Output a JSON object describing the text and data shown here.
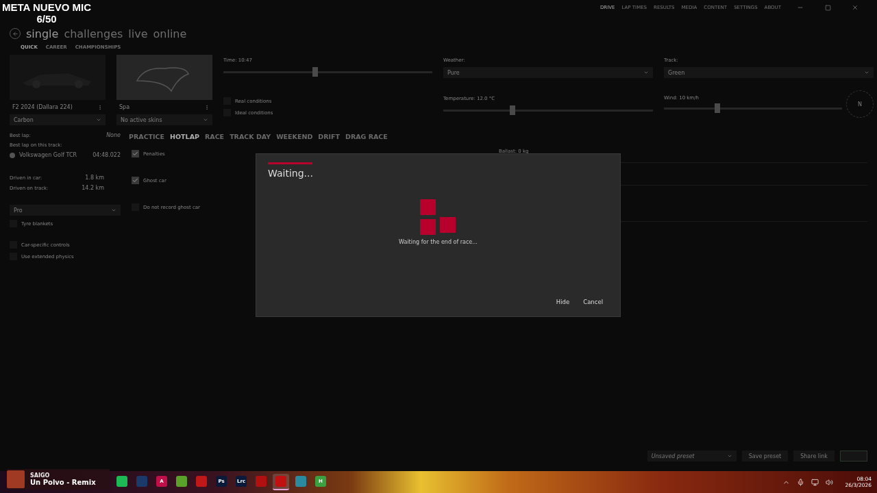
{
  "overlay": {
    "title": "META NUEVO MIC",
    "count": "6/50"
  },
  "nav": [
    {
      "label": "DRIVE",
      "selected": true
    },
    {
      "label": "LAP TIMES",
      "selected": false
    },
    {
      "label": "RESULTS",
      "selected": false
    },
    {
      "label": "MEDIA",
      "selected": false
    },
    {
      "label": "CONTENT",
      "selected": false
    },
    {
      "label": "SETTINGS",
      "selected": false
    },
    {
      "label": "ABOUT",
      "selected": false
    }
  ],
  "title_tabs": [
    {
      "label": "single",
      "selected": true
    },
    {
      "label": "challenges",
      "selected": false
    },
    {
      "label": "live",
      "selected": false
    },
    {
      "label": "online",
      "selected": false
    }
  ],
  "subtabs": [
    {
      "label": "QUICK",
      "selected": true
    },
    {
      "label": "CAREER",
      "selected": false
    },
    {
      "label": "CHAMPIONSHIPS",
      "selected": false
    }
  ],
  "car": {
    "name": "F2 2024 (Dallara 224)",
    "skin": "Carbon"
  },
  "track": {
    "name": "Spa",
    "skins": "No active skins"
  },
  "time": {
    "label": "Time: 10:47",
    "level": 0.44
  },
  "conditions": [
    {
      "label": "Real conditions",
      "checked": false
    },
    {
      "label": "Ideal conditions",
      "checked": false
    }
  ],
  "weather": {
    "label": "Weather:",
    "value": "Pure"
  },
  "track_state": {
    "label": "Track:",
    "value": "Green"
  },
  "temperature": {
    "label": "Temperature: 12.0 °C",
    "level": 0.33
  },
  "wind": {
    "label": "Wind: 10 km/h",
    "level": 0.3,
    "direction": "N"
  },
  "stats": {
    "best_lap_label": "Best lap:",
    "best_lap": "None",
    "best_track_label": "Best lap on this track:",
    "record_car": "Volkswagen Golf TCR",
    "record_time": "04:48.022",
    "rows": [
      {
        "label": "Driven in car:",
        "value": "1.8 km"
      },
      {
        "label": "Driven on track:",
        "value": "14.2 km"
      }
    ]
  },
  "assists": {
    "preset": "Pro",
    "items": [
      {
        "label": "Tyre blankets",
        "checked": false
      },
      {
        "label": "Car-specific controls",
        "checked": false
      },
      {
        "label": "Use extended physics",
        "checked": false
      }
    ]
  },
  "modes": [
    {
      "label": "PRACTICE",
      "selected": false
    },
    {
      "label": "HOTLAP",
      "selected": true
    },
    {
      "label": "RACE",
      "selected": false
    },
    {
      "label": "TRACK DAY",
      "selected": false
    },
    {
      "label": "WEEKEND",
      "selected": false
    },
    {
      "label": "DRIFT",
      "selected": false
    },
    {
      "label": "DRAG RACE",
      "selected": false
    }
  ],
  "options": [
    {
      "label": "Penalties",
      "checked": true
    },
    {
      "label": "Ghost car",
      "checked": true
    },
    {
      "label": "Do not record ghost car",
      "checked": false
    }
  ],
  "ballast": "Ballast: 0 kg",
  "dialog": {
    "title": "Waiting...",
    "message": "Waiting for the end of race...",
    "buttons": [
      "Hide",
      "Cancel"
    ]
  },
  "footer": {
    "preset": "Unsaved preset",
    "buttons": [
      "Save preset",
      "Share link"
    ]
  },
  "media": {
    "artist": "SAIGO",
    "song": "Un Polvo - Remix"
  },
  "taskbar_apps": [
    {
      "kind": "spotify"
    },
    {
      "kind": "steam"
    },
    {
      "kind": "arrow",
      "label": "A"
    },
    {
      "kind": "block"
    },
    {
      "kind": "play"
    },
    {
      "kind": "photo",
      "label": "Ps"
    },
    {
      "kind": "lightroom",
      "label": "Lrc"
    },
    {
      "kind": "racing"
    },
    {
      "kind": "game",
      "selected": true
    },
    {
      "kind": "bird"
    },
    {
      "kind": "hub",
      "label": "H"
    }
  ],
  "clock": {
    "time": "08:04",
    "date": "26/3/2026"
  }
}
